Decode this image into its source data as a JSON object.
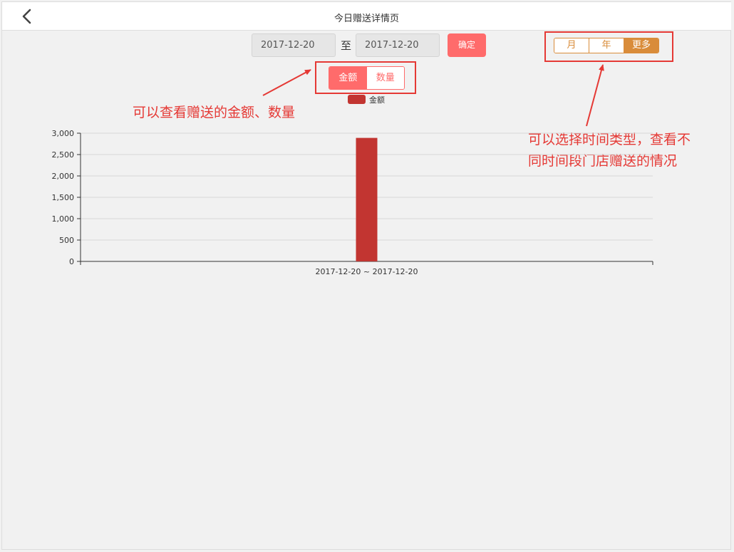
{
  "header": {
    "title": "今日赠送详情页",
    "back_icon": "chevron-left-icon"
  },
  "filter": {
    "start_date": "2017-12-20",
    "to_label": "至",
    "end_date": "2017-12-20",
    "confirm_label": "确定"
  },
  "period_tabs": [
    {
      "label": "月",
      "active": false
    },
    {
      "label": "年",
      "active": false
    },
    {
      "label": "更多",
      "active": true
    }
  ],
  "metric_tabs": [
    {
      "label": "金额",
      "active": true
    },
    {
      "label": "数量",
      "active": false
    }
  ],
  "annotations": {
    "metric_note": "可以查看赠送的金额、数量",
    "period_note_line1": "可以选择时间类型，查看不",
    "period_note_line2": "同时间段门店赠送的情况"
  },
  "colors": {
    "accent_pink": "#ff6b6b",
    "accent_orange": "#d98c3a",
    "annotation_red": "#e53935",
    "bar": "#c23531"
  },
  "chart_data": {
    "type": "bar",
    "categories": [
      "2017-12-20 ~ 2017-12-20"
    ],
    "series": [
      {
        "name": "金额",
        "values": [
          2890
        ]
      }
    ],
    "ylim": [
      0,
      3000
    ],
    "yticks": [
      0,
      500,
      1000,
      1500,
      2000,
      2500,
      3000
    ],
    "ytick_labels": [
      "0",
      "500",
      "1,000",
      "1,500",
      "2,000",
      "2,500",
      "3,000"
    ],
    "grid": true,
    "legend": "top-center"
  }
}
